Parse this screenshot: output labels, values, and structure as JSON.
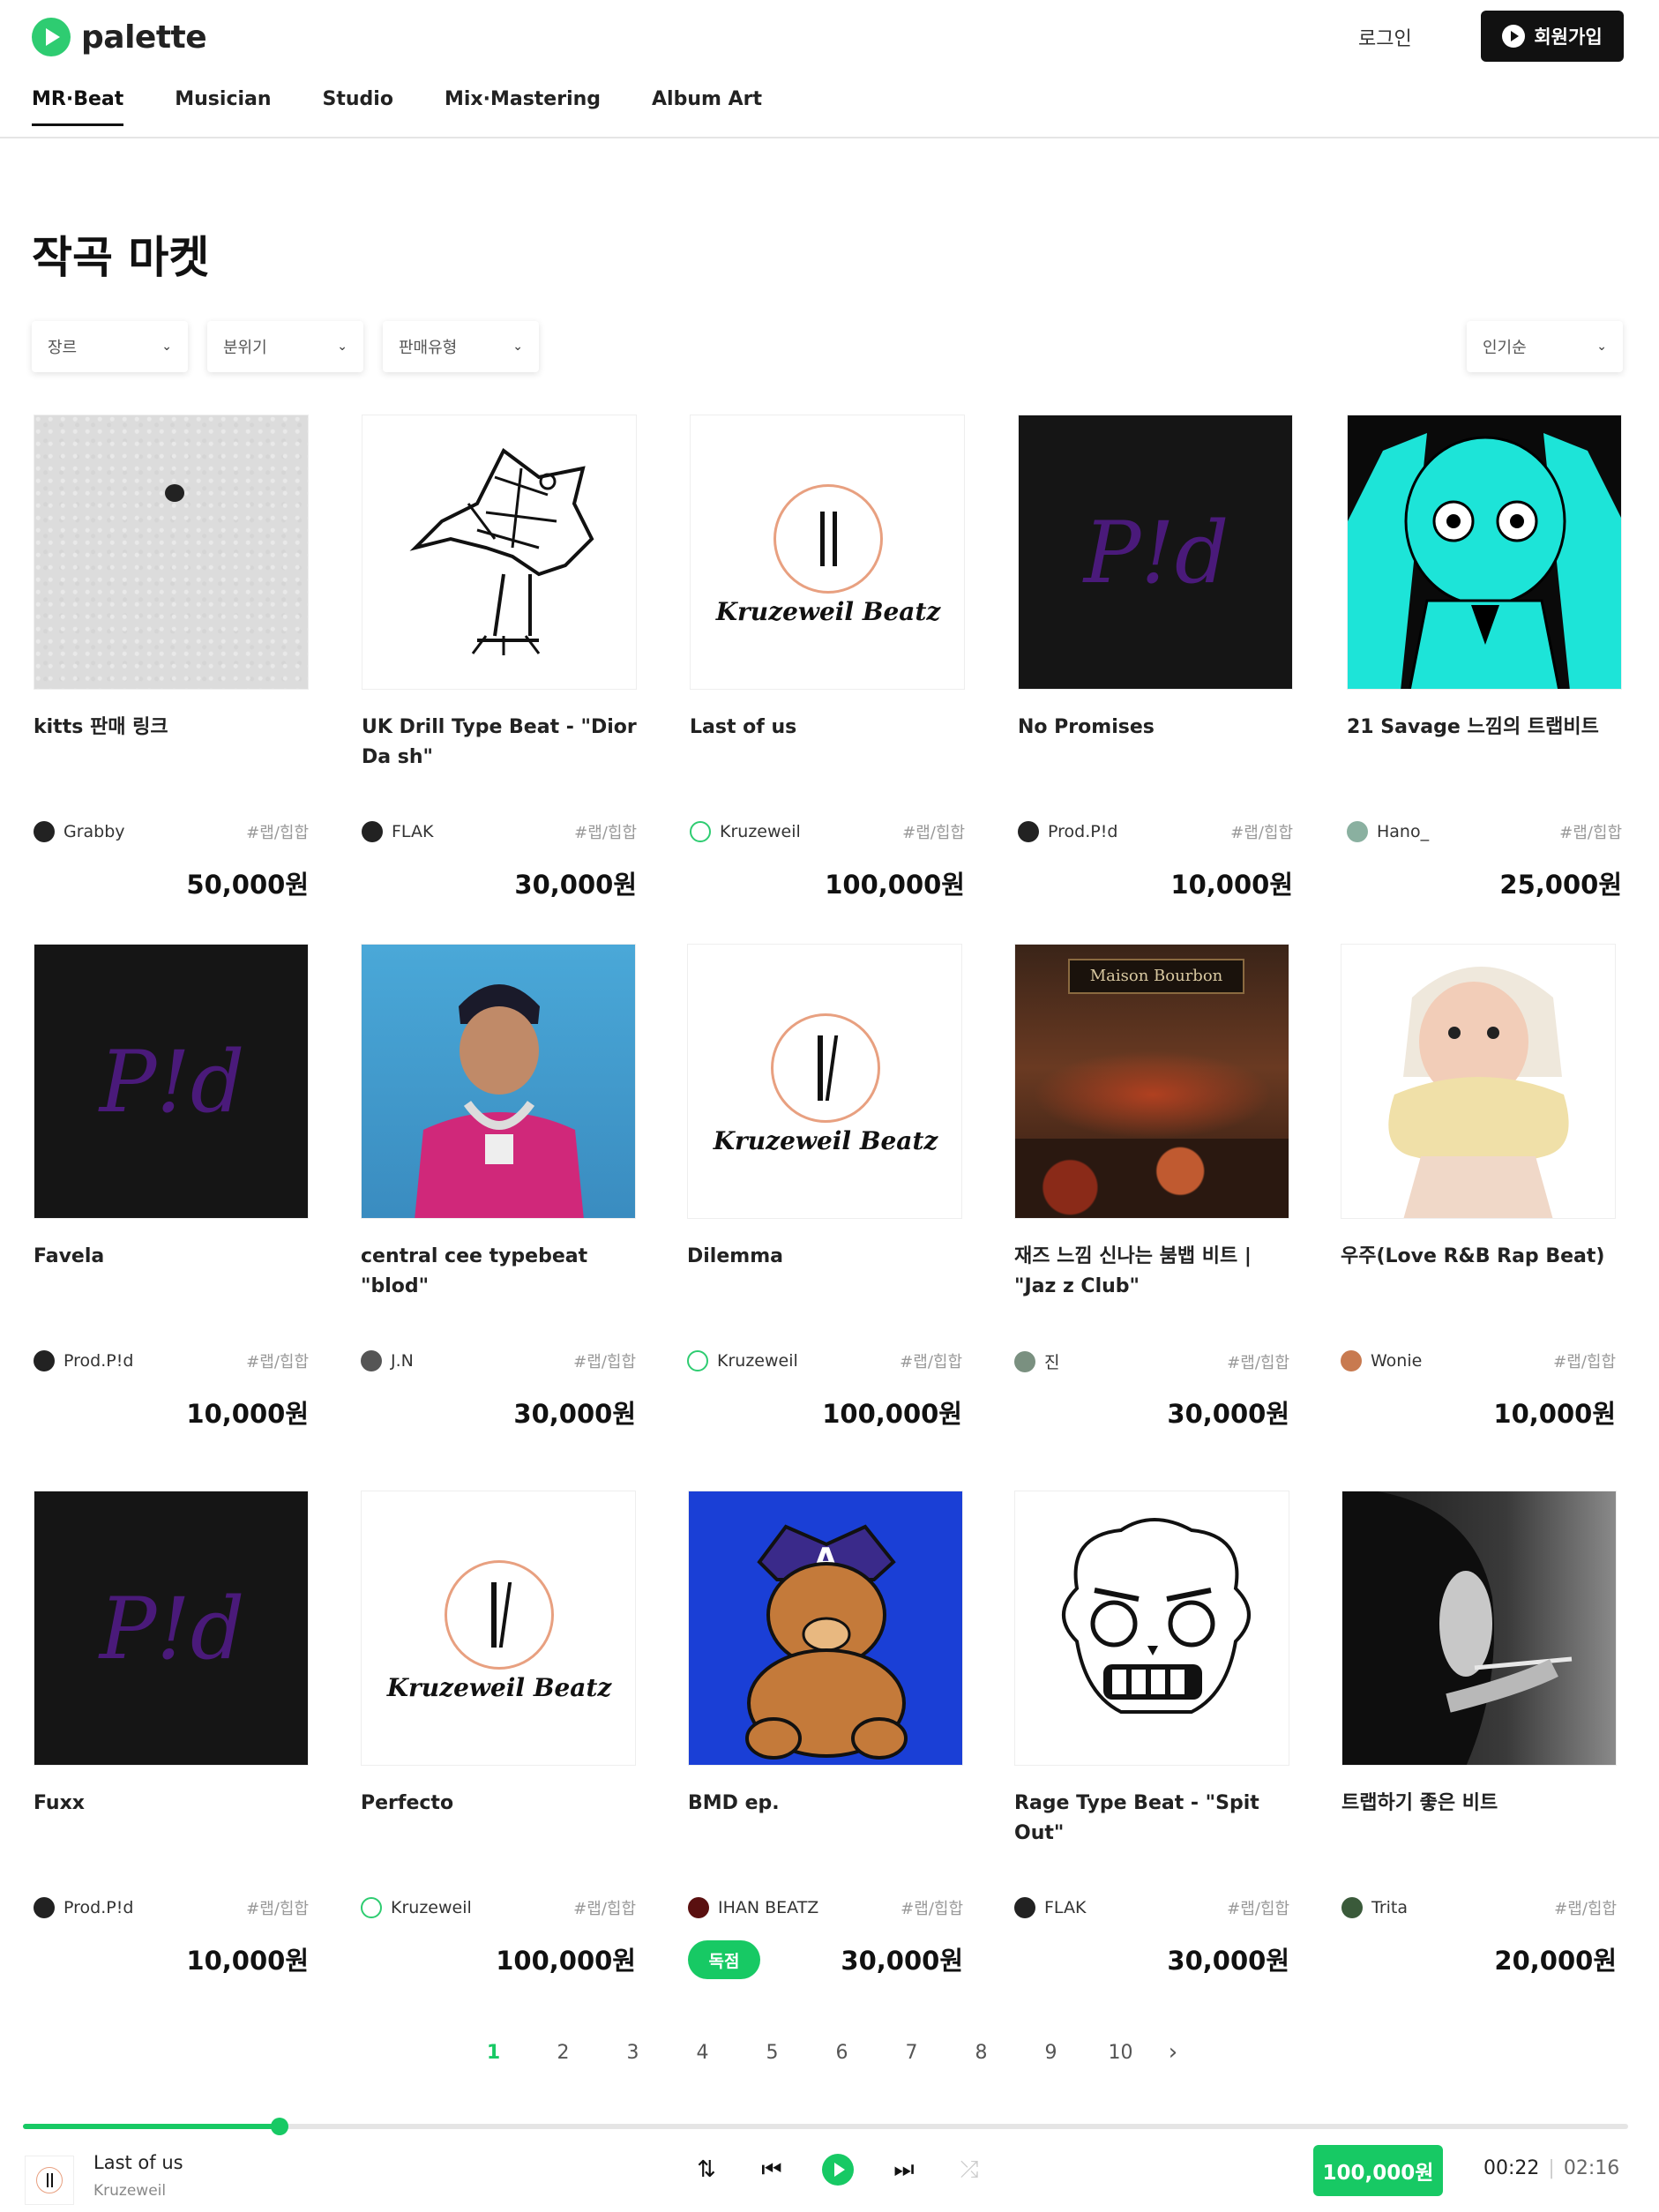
{
  "header": {
    "logo_text": "palette",
    "login": "로그인",
    "signup": "회원가입",
    "nav": [
      "MR·Beat",
      "Musician",
      "Studio",
      "Mix·Mastering",
      "Album Art"
    ]
  },
  "page_title": "작곡 마켓",
  "filters": {
    "genre": "장르",
    "mood": "분위기",
    "sale_type": "판매유형",
    "sort": "인기순"
  },
  "cards": [
    {
      "title": "kitts 판매 링크",
      "artist": "Grabby",
      "genre": "#랩/힙합",
      "price": "50,000원"
    },
    {
      "title": "UK Drill Type Beat - \"Dior Da sh\"",
      "artist": "FLAK",
      "genre": "#랩/힙합",
      "price": "30,000원"
    },
    {
      "title": "Last of us",
      "artist": "Kruzeweil",
      "genre": "#랩/힙합",
      "price": "100,000원"
    },
    {
      "title": "No Promises",
      "artist": "Prod.P!d",
      "genre": "#랩/힙합",
      "price": "10,000원"
    },
    {
      "title": "21 Savage 느낌의 트랩비트",
      "artist": "Hano_",
      "genre": "#랩/힙합",
      "price": "25,000원"
    },
    {
      "title": "Favela",
      "artist": "Prod.P!d",
      "genre": "#랩/힙합",
      "price": "10,000원"
    },
    {
      "title": "central cee typebeat \"blod\"",
      "artist": "J.N",
      "genre": "#랩/힙합",
      "price": "30,000원"
    },
    {
      "title": "Dilemma",
      "artist": "Kruzeweil",
      "genre": "#랩/힙합",
      "price": "100,000원"
    },
    {
      "title": "재즈 느낌 신나는 붐뱁 비트 | \"Jaz z Club\"",
      "artist": "진",
      "genre": "#랩/힙합",
      "price": "30,000원"
    },
    {
      "title": "우주(Love R&B Rap Beat)",
      "artist": "Wonie",
      "genre": "#랩/힙합",
      "price": "10,000원"
    },
    {
      "title": "Fuxx",
      "artist": "Prod.P!d",
      "genre": "#랩/힙합",
      "price": "10,000원"
    },
    {
      "title": "Perfecto",
      "artist": "Kruzeweil",
      "genre": "#랩/힙합",
      "price": "100,000원"
    },
    {
      "title": "BMD ep.",
      "artist": "IHAN BEATZ",
      "genre": "#랩/힙합",
      "price": "30,000원",
      "badge": "독점"
    },
    {
      "title": "Rage Type Beat - \"Spit Out\"",
      "artist": "FLAK",
      "genre": "#랩/힙합",
      "price": "30,000원"
    },
    {
      "title": "트랩하기 좋은 비트",
      "artist": "Trita",
      "genre": "#랩/힙합",
      "price": "20,000원"
    }
  ],
  "art_text": {
    "pid": "P!d",
    "kruzeweil": "Kruzeweil Beatz",
    "kruzeweil_small": "Kruzeweil Beatz",
    "jazz_sign": "Maison Bourbon"
  },
  "pagination": {
    "pages": [
      "1",
      "2",
      "3",
      "4",
      "5",
      "6",
      "7",
      "8",
      "9",
      "10"
    ],
    "current": "1"
  },
  "player": {
    "title": "Last of us",
    "artist": "Kruzeweil",
    "price": "100,000원",
    "elapsed": "00:22",
    "total": "02:16",
    "progress": 0.16
  },
  "colors": {
    "accent": "#17c964",
    "dark": "#111111",
    "pid_purple": "#4a1a7a",
    "miku_cyan": "#1de4d8",
    "bmd_blue": "#1a3fd6"
  }
}
